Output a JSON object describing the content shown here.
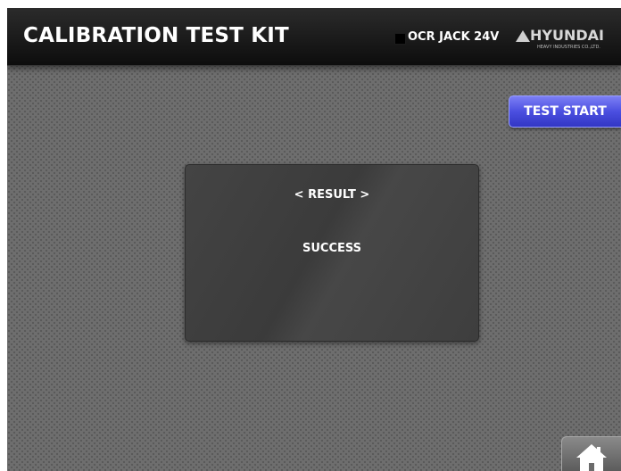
{
  "header": {
    "title": "CALIBRATION TEST KIT",
    "device_label": "OCR JACK 24V",
    "logo_text": "HYUNDAI",
    "logo_subtext": "HEAVY INDUSTRIES CO.,LTD."
  },
  "actions": {
    "test_start_label": "TEST START"
  },
  "result": {
    "heading": "< RESULT >",
    "value": "SUCCESS"
  },
  "icons": {
    "status": "status-indicator-square",
    "logo": "hyundai-logo-icon",
    "home": "home-icon"
  },
  "colors": {
    "header_bg": "#141414",
    "background": "#6e6e6e",
    "accent_button": "#4b4fe0",
    "panel_bg": "#404040",
    "text": "#ffffff"
  }
}
